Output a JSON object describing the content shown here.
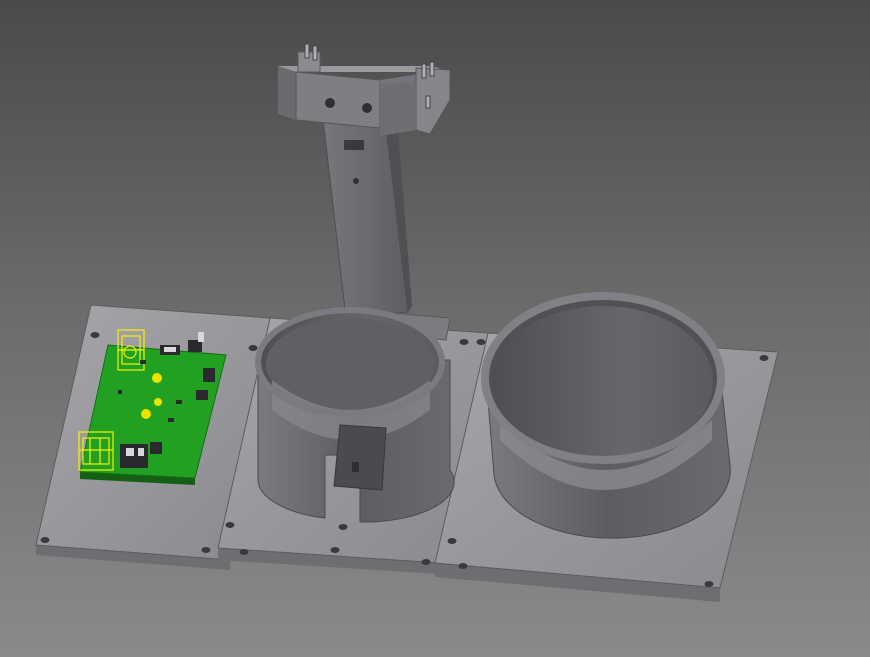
{
  "viewport": {
    "background_top": "#4a4a4a",
    "background_bottom": "#8a8a8a"
  },
  "model": {
    "plate_color": "#8e8e92",
    "plate_top_color": "#a0a0a4",
    "cup_color": "#6c6c72",
    "cup_inner_color": "#58585e",
    "pcb_color": "#22a022",
    "highlight_color": "#f2f200"
  }
}
